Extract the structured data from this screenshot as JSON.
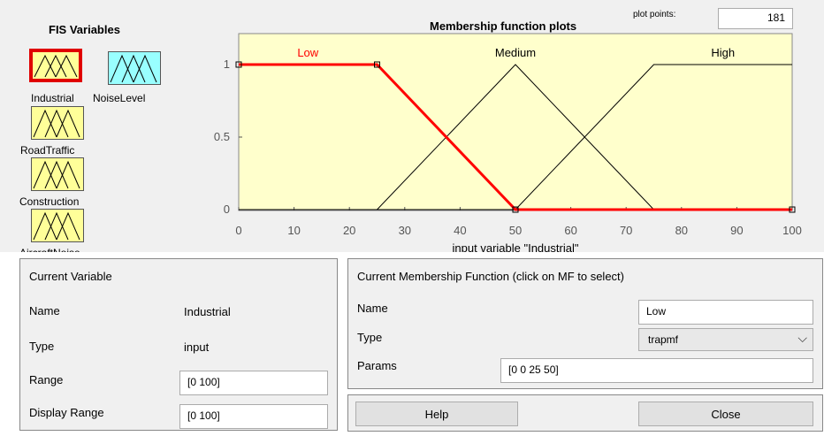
{
  "fis_variables": {
    "title": "FIS Variables",
    "items": [
      {
        "label": "Industrial",
        "selected": true,
        "color": "#ffff99"
      },
      {
        "label": "NoiseLevel",
        "selected": false,
        "color": "#99ffff"
      },
      {
        "label": "RoadTraffic",
        "selected": false,
        "color": "#ffff99"
      },
      {
        "label": "Construction",
        "selected": false,
        "color": "#ffff99"
      },
      {
        "label": "AircraftNoise",
        "selected": false,
        "color": "#ffff99"
      }
    ]
  },
  "plot": {
    "title": "Membership function plots",
    "plot_points_label": "plot points:",
    "plot_points_value": "181",
    "xlabel": "input variable \"Industrial\""
  },
  "chart_data": {
    "type": "line",
    "xlim": [
      0,
      100
    ],
    "ylim": [
      0,
      1
    ],
    "x_ticks": [
      "0",
      "10",
      "20",
      "30",
      "40",
      "50",
      "60",
      "70",
      "80",
      "90",
      "100"
    ],
    "y_ticks": [
      "0",
      "0.5",
      "1"
    ],
    "background": "#ffffcc",
    "series": [
      {
        "name": "Low",
        "points": [
          [
            0,
            1
          ],
          [
            25,
            1
          ],
          [
            50,
            0
          ],
          [
            100,
            0
          ]
        ],
        "color": "#ff0000",
        "selected": true
      },
      {
        "name": "Medium",
        "points": [
          [
            0,
            0
          ],
          [
            25,
            0
          ],
          [
            50,
            1
          ],
          [
            75,
            0
          ],
          [
            100,
            0
          ]
        ],
        "color": "#000000",
        "selected": false
      },
      {
        "name": "High",
        "points": [
          [
            0,
            0
          ],
          [
            50,
            0
          ],
          [
            75,
            1
          ],
          [
            100,
            1
          ]
        ],
        "color": "#000000",
        "selected": false
      }
    ]
  },
  "current_variable": {
    "header": "Current Variable",
    "name_label": "Name",
    "name_value": "Industrial",
    "type_label": "Type",
    "type_value": "input",
    "range_label": "Range",
    "range_value": "[0 100]",
    "display_range_label": "Display Range",
    "display_range_value": "[0 100]"
  },
  "current_mf": {
    "header": "Current Membership Function (click on MF to select)",
    "name_label": "Name",
    "name_value": "Low",
    "type_label": "Type",
    "type_value": "trapmf",
    "params_label": "Params",
    "params_value": "[0 0 25 50]"
  },
  "buttons": {
    "help": "Help",
    "close": "Close"
  }
}
